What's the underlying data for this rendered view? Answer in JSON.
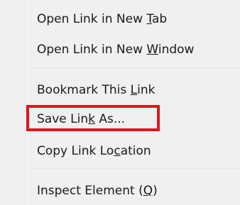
{
  "menu": {
    "items": [
      {
        "before": "Open Link in New ",
        "accel": "T",
        "after": "ab"
      },
      {
        "before": "Open Link in New ",
        "accel": "W",
        "after": "indow"
      },
      {
        "before": "Bookmark This ",
        "accel": "L",
        "after": "ink"
      },
      {
        "before": "Save Lin",
        "accel": "k",
        "after": " As..."
      },
      {
        "before": "Copy Link Lo",
        "accel": "c",
        "after": "ation"
      },
      {
        "before": "Inspect Element (",
        "accel": "Q",
        "after": ")"
      }
    ]
  },
  "colors": {
    "menu_background": "#f0f0f0",
    "highlight_border": "#e0161f",
    "text": "#1a1a1a"
  }
}
